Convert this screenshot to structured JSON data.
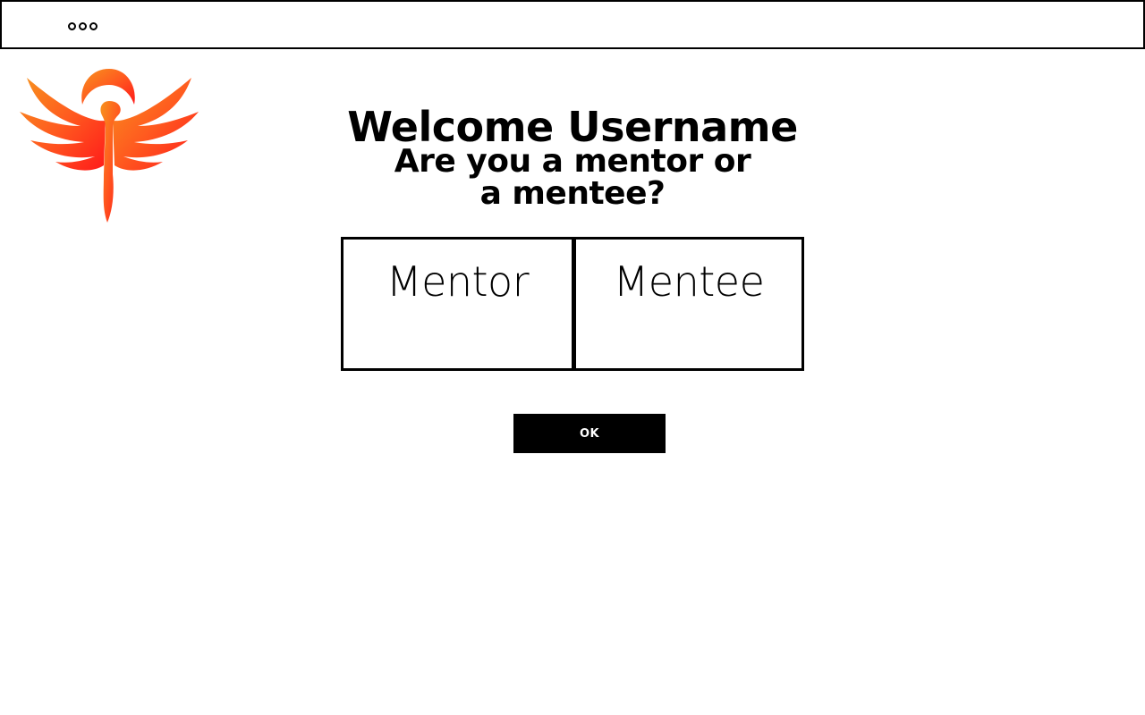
{
  "topbar": {
    "menu_icon": "three-dots-icon"
  },
  "logo": {
    "icon": "phoenix-logo",
    "colors": [
      "#f7931e",
      "#ff5a1f",
      "#ff1a1a"
    ]
  },
  "heading": {
    "welcome": "Welcome Username",
    "question": "Are you a mentor or a mentee?"
  },
  "choices": [
    {
      "label": "Mentor"
    },
    {
      "label": "Mentee"
    }
  ],
  "ok_button": {
    "label": "OK"
  }
}
